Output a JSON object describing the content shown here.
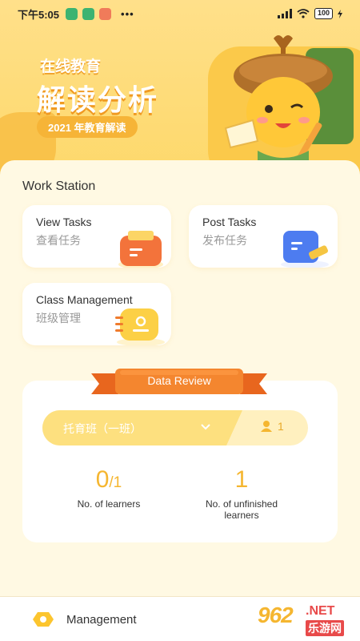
{
  "status_bar": {
    "time": "下午5:05",
    "dots": "•••",
    "battery": "100"
  },
  "banner": {
    "small_title": "在线教育",
    "big_title": "解读分析",
    "pill": "2021 年教育解读"
  },
  "work_station": {
    "title": "Work Station",
    "cards": [
      {
        "title": "View Tasks",
        "subtitle": "查看任务",
        "icon": "clipboard-icon"
      },
      {
        "title": "Post Tasks",
        "subtitle": "发布任务",
        "icon": "note-pencil-icon"
      },
      {
        "title": "Class Management",
        "subtitle": "班级管理",
        "icon": "notebook-icon"
      }
    ]
  },
  "data_review": {
    "title": "Data Review",
    "class_name": "托育班（一班）",
    "member_count": "1",
    "stats": [
      {
        "value": "0",
        "suffix": "/1",
        "label": "No. of learners"
      },
      {
        "value": "1",
        "suffix": "",
        "label": "No. of unfinished learners"
      }
    ]
  },
  "bottom_nav": {
    "management_label": "Management"
  },
  "watermark": {
    "number": "962",
    "net": ".NET",
    "cn": "乐游网"
  },
  "colors": {
    "accent": "#f5b630",
    "ribbon": "#f07b2c",
    "banner": "#fdd86a"
  }
}
